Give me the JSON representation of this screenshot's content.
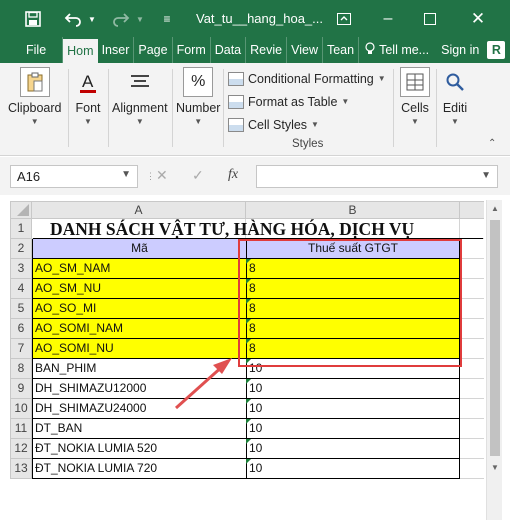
{
  "window": {
    "title": "Vat_tu__hang_hoa_...",
    "user_initial": "R"
  },
  "ribbon_tabs": [
    "File",
    "Hom",
    "Inser",
    "Page",
    "Form",
    "Data",
    "Revie",
    "View",
    "Tean"
  ],
  "tell_me": "Tell me...",
  "sign_in": "Sign in",
  "ribbon": {
    "clipboard": "Clipboard",
    "font": "Font",
    "alignment": "Alignment",
    "number": "Number",
    "conditional_formatting": "Conditional Formatting",
    "format_as_table": "Format as Table",
    "cell_styles": "Cell Styles",
    "styles_group": "Styles",
    "cells": "Cells",
    "editing": "Editi"
  },
  "formula_bar": {
    "name_box": "A16",
    "fx_label": "fx",
    "formula": ""
  },
  "sheet": {
    "columns": [
      "A",
      "B"
    ],
    "row_numbers": [
      "1",
      "2",
      "3",
      "4",
      "5",
      "6",
      "7",
      "8",
      "9",
      "10",
      "11",
      "12",
      "13"
    ],
    "title": "DANH SÁCH VẬT TƯ, HÀNG HÓA, DỊCH VỤ",
    "header": [
      "Mã",
      "Thuế suất GTGT"
    ],
    "rows": [
      {
        "code": "AO_SM_NAM",
        "tax": "8"
      },
      {
        "code": "AO_SM_NU",
        "tax": "8"
      },
      {
        "code": "AO_SO_MI",
        "tax": "8"
      },
      {
        "code": "AO_SOMI_NAM",
        "tax": "8"
      },
      {
        "code": "AO_SOMI_NU",
        "tax": "8"
      },
      {
        "code": "BAN_PHIM",
        "tax": "10"
      },
      {
        "code": "DH_SHIMAZU12000",
        "tax": "10"
      },
      {
        "code": "DH_SHIMAZU24000",
        "tax": "10"
      },
      {
        "code": "DT_BAN",
        "tax": "10"
      },
      {
        "code": "ĐT_NOKIA LUMIA 520",
        "tax": "10"
      },
      {
        "code": "ĐT_NOKIA LUMIA 720",
        "tax": "10"
      }
    ]
  },
  "colors": {
    "excel_green": "#217346",
    "highlight_yellow": "#ffff00",
    "header_lavender": "#ccccff",
    "annotation_red": "#e03c3c"
  }
}
